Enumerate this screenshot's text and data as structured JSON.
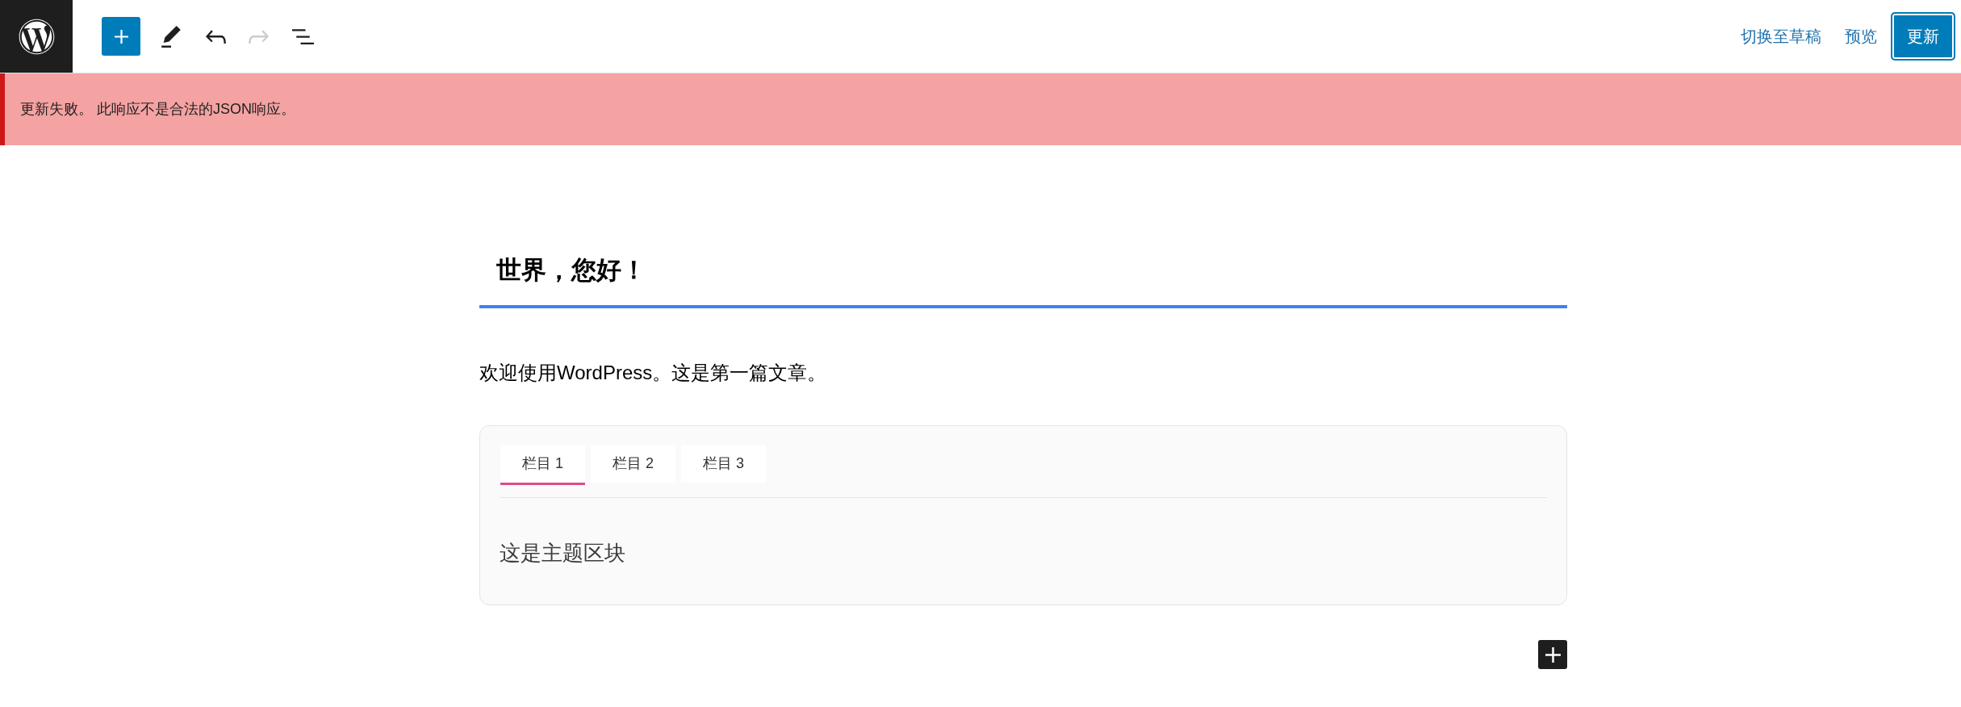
{
  "toolbar": {
    "undo": {
      "disabled": false
    },
    "redo": {
      "disabled": true
    }
  },
  "actions": [
    {
      "kind": "link",
      "label": "切换至草稿"
    },
    {
      "kind": "link",
      "label": "预览"
    },
    {
      "kind": "primary",
      "label": "更新"
    }
  ],
  "notice": {
    "kind": "error",
    "text": "更新失败。 此响应不是合法的JSON响应。"
  },
  "post": {
    "title": {
      "text": "世界，您好！",
      "focused": true
    },
    "paragraph": "欢迎使用WordPress。这是第一篇文章。"
  },
  "tabs_block": {
    "tabs": [
      {
        "label": "栏目 1",
        "selected": true
      },
      {
        "label": "栏目 2",
        "selected": false
      },
      {
        "label": "栏目 3",
        "selected": false
      }
    ],
    "panel_text": "这是主题区块"
  }
}
